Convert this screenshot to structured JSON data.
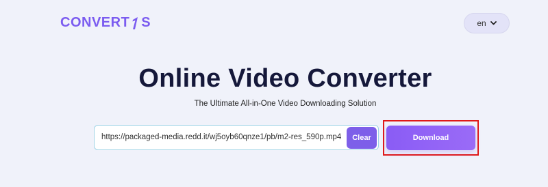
{
  "header": {
    "logo_text": "CONVERT",
    "logo_suffix": "S",
    "language": "en"
  },
  "hero": {
    "title": "Online Video Converter",
    "subtitle": "The Ultimate All-in-One Video Downloading Solution"
  },
  "converter": {
    "url_value": "https://packaged-media.redd.it/wj5oyb60qnze1/pb/m2-res_590p.mp4",
    "clear_label": "Clear",
    "download_label": "Download"
  },
  "colors": {
    "brand": "#7b5cf0",
    "title": "#15183a",
    "background": "#f0f2fa",
    "highlight": "#e01818"
  },
  "icons": {
    "logo_mark": "number-1-icon",
    "language_dropdown": "chevron-down-icon"
  }
}
